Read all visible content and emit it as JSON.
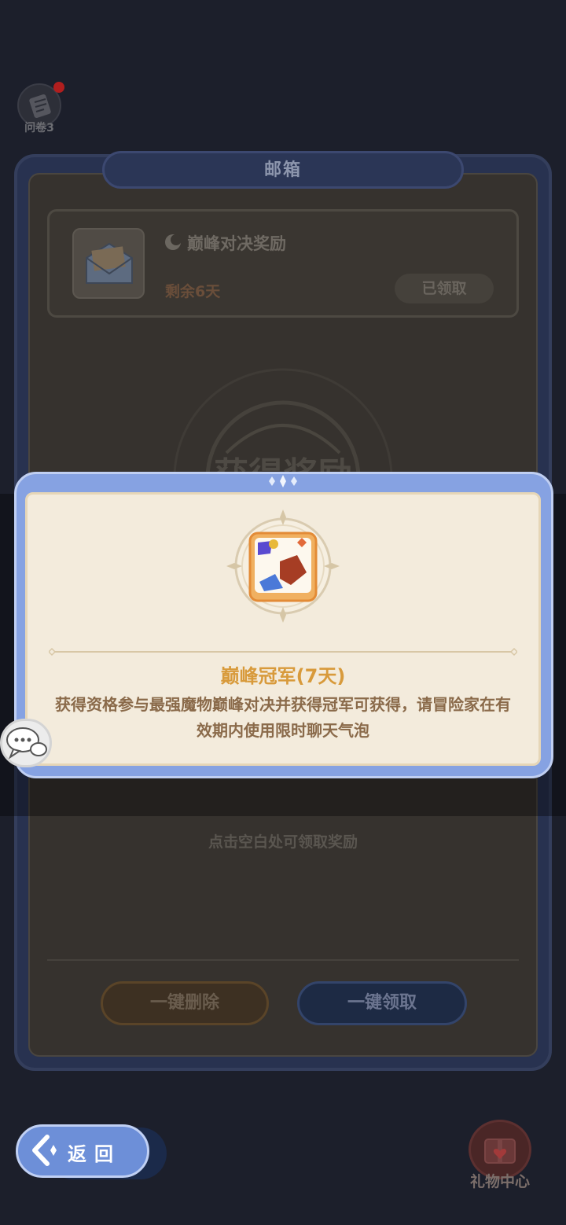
{
  "survey": {
    "label": "问卷3"
  },
  "mailbox": {
    "title": "邮箱",
    "mail": {
      "title": "巅峰对决奖励",
      "remaining": "剩余6天",
      "status": "已领取"
    },
    "background_title": "获得奖励",
    "tap_hint": "点击空白处可领取奖励",
    "delete_all": "一键删除",
    "claim_all": "一键领取"
  },
  "popup": {
    "item_name": "巅峰冠军(7天)",
    "description": "获得资格参与最强魔物巅峰对决并获得冠军可获得，请冒险家在有效期内使用限时聊天气泡"
  },
  "nav": {
    "back": "返回",
    "gift_center": "礼物中心"
  },
  "icons": {
    "survey": "survey-icon",
    "mail": "envelope-icon",
    "chat": "chat-bubble-icon",
    "back": "back-arrow-icon",
    "gift": "gift-box-icon"
  },
  "colors": {
    "popup_frame": "#86a2e2",
    "popup_body": "#f3ebdc",
    "item_title": "#d89a3b",
    "description": "#8a6a4a",
    "back_button": "#6d8fd8"
  }
}
